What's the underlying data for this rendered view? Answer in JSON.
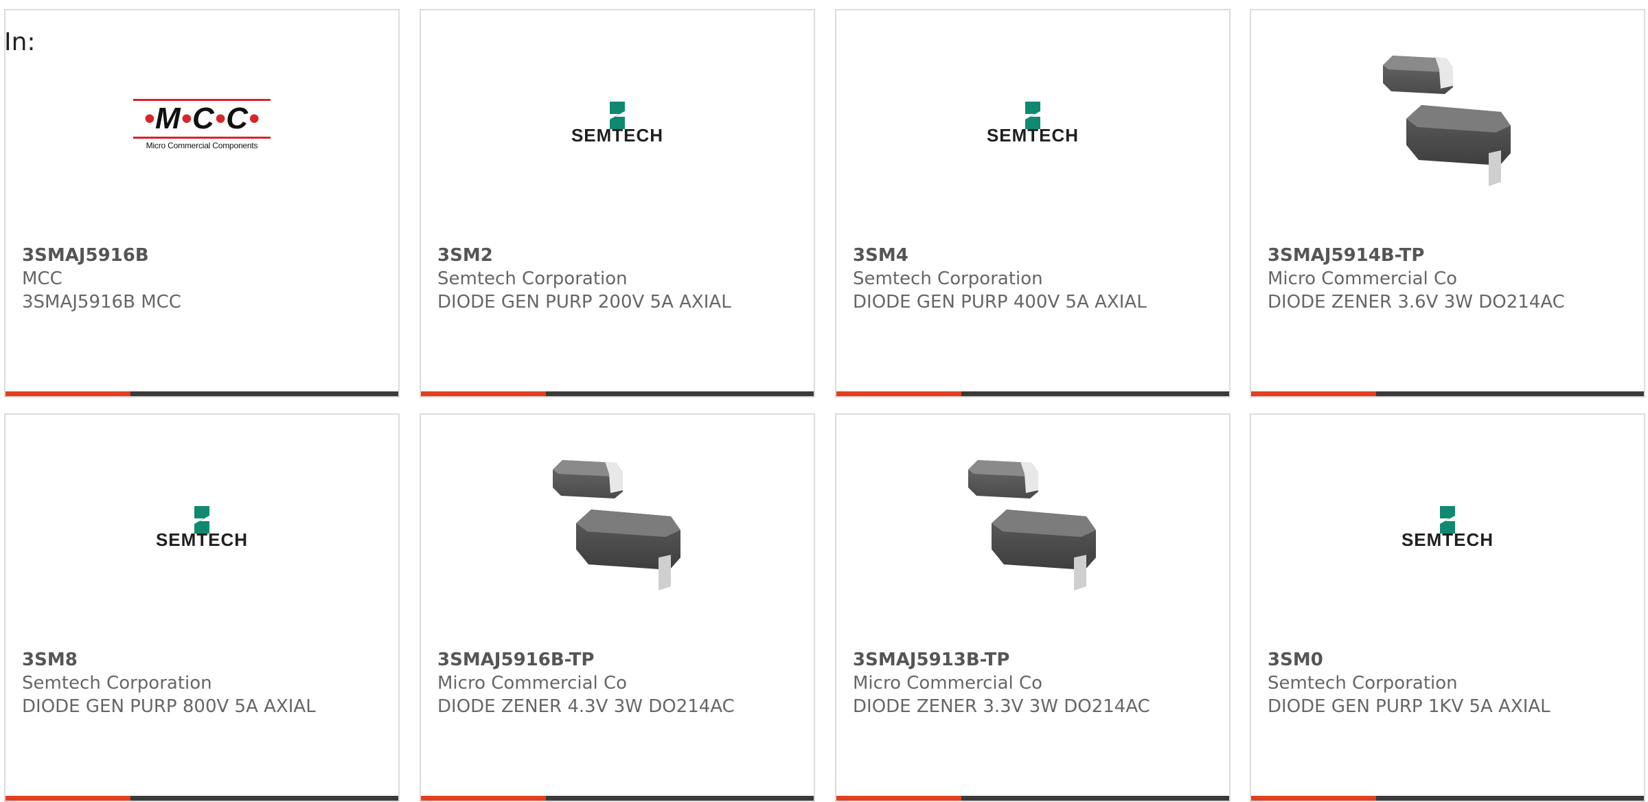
{
  "header": {
    "in_label": "In:"
  },
  "colors": {
    "accent": "#e2401c",
    "bar": "#3a3a3a",
    "semtech_green": "#0f8a70",
    "mcc_red": "#d8242b"
  },
  "cards": [
    {
      "part": "3SMAJ5916B",
      "maker": "MCC",
      "desc": "3SMAJ5916B MCC",
      "image": "mcc-logo"
    },
    {
      "part": "3SM2",
      "maker": "Semtech Corporation",
      "desc": "DIODE GEN PURP 200V 5A AXIAL",
      "image": "semtech-logo"
    },
    {
      "part": "3SM4",
      "maker": "Semtech Corporation",
      "desc": "DIODE GEN PURP 400V 5A AXIAL",
      "image": "semtech-logo"
    },
    {
      "part": "3SMAJ5914B-TP",
      "maker": "Micro Commercial Co",
      "desc": "DIODE ZENER 3.6V 3W DO214AC",
      "image": "smd-diode-photo"
    },
    {
      "part": "3SM8",
      "maker": "Semtech Corporation",
      "desc": "DIODE GEN PURP 800V 5A AXIAL",
      "image": "semtech-logo"
    },
    {
      "part": "3SMAJ5916B-TP",
      "maker": "Micro Commercial Co",
      "desc": "DIODE ZENER 4.3V 3W DO214AC",
      "image": "smd-diode-photo"
    },
    {
      "part": "3SMAJ5913B-TP",
      "maker": "Micro Commercial Co",
      "desc": "DIODE ZENER 3.3V 3W DO214AC",
      "image": "smd-diode-photo"
    },
    {
      "part": "3SM0",
      "maker": "Semtech Corporation",
      "desc": "DIODE GEN PURP 1KV 5A AXIAL",
      "image": "semtech-logo"
    }
  ],
  "logos": {
    "mcc": {
      "word": "M·C·C",
      "sub": "Micro Commercial Components"
    },
    "semtech": {
      "word": "SEMTECH"
    }
  }
}
